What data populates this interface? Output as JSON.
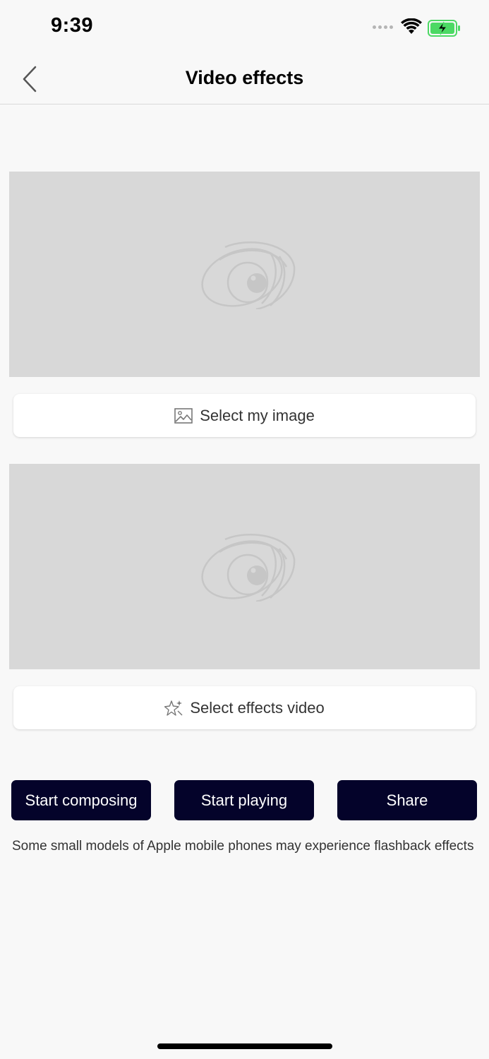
{
  "status_bar": {
    "time": "9:39"
  },
  "nav": {
    "title": "Video effects"
  },
  "select_image": {
    "label": "Select my image"
  },
  "select_video": {
    "label": "Select effects video"
  },
  "actions": {
    "compose_label": "Start composing",
    "play_label": "Start playing",
    "share_label": "Share"
  },
  "notice": {
    "text": "Some small models of Apple mobile phones may experience flashback effects"
  },
  "colors": {
    "button_bg": "#04032a",
    "placeholder_bg": "#d8d8d8",
    "battery_green": "#4cd964"
  },
  "icons": {
    "back": "chevron-left-icon",
    "image": "image-icon",
    "effects": "sparkle-star-icon",
    "placeholder": "eye-logo-icon"
  }
}
